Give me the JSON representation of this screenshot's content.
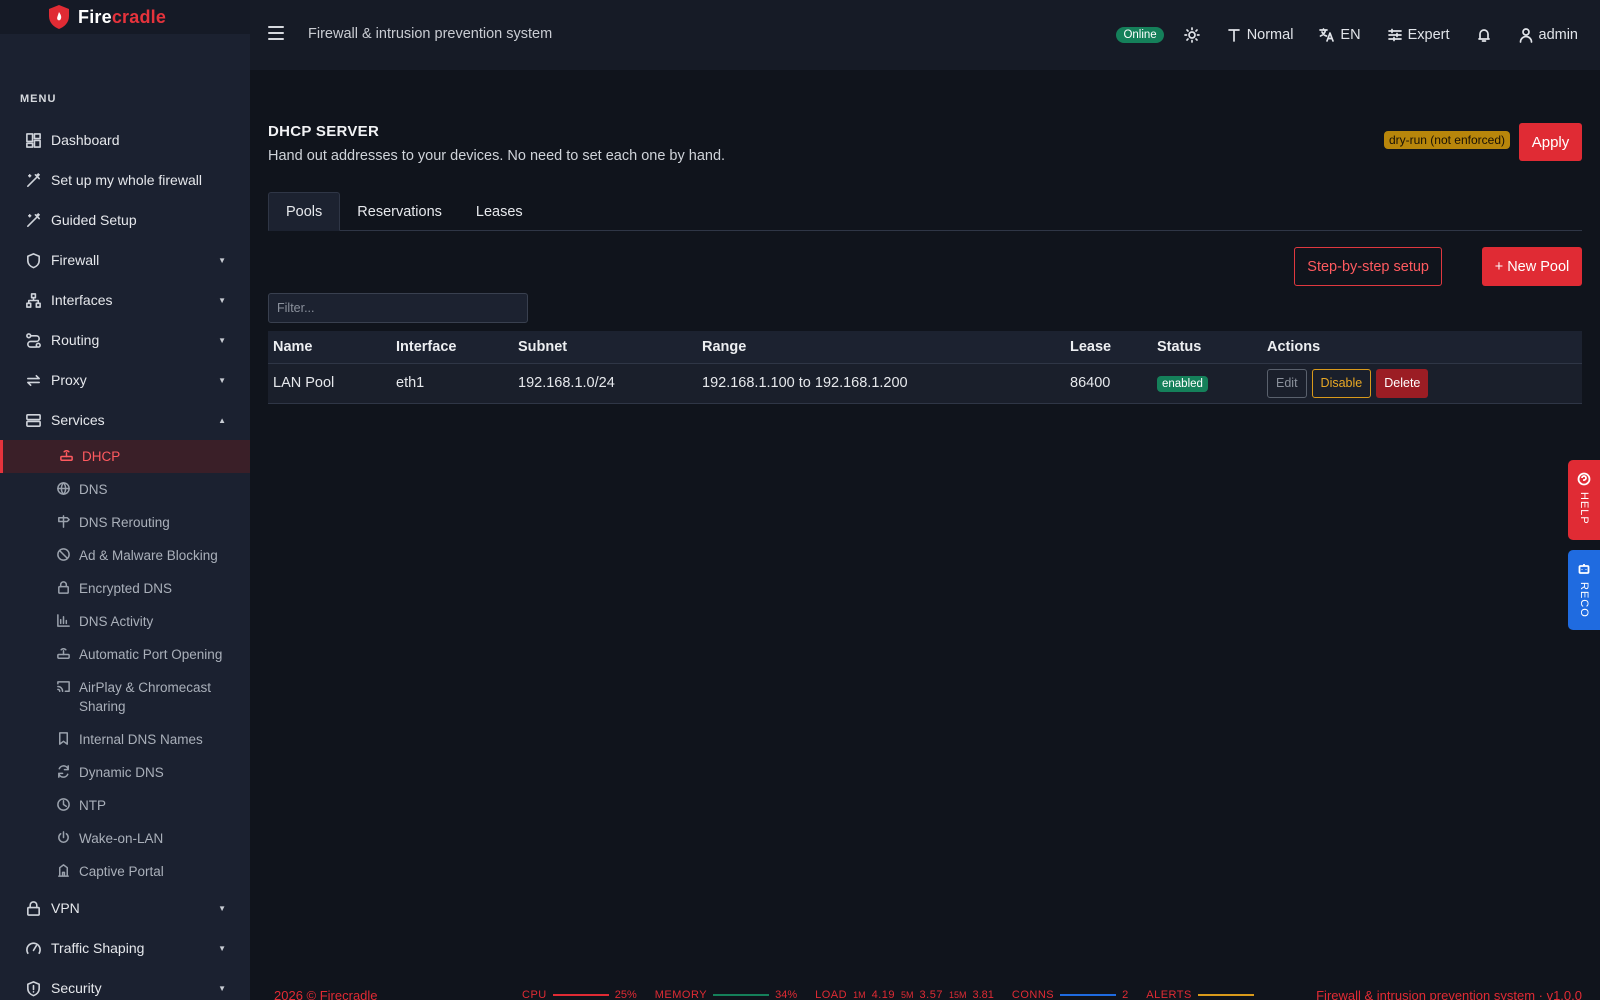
{
  "brand": {
    "prefix": "Fire",
    "suffix": "cradle"
  },
  "sidebar": {
    "menu_heading": "MENU",
    "top_items": [
      {
        "label": "Dashboard"
      },
      {
        "label": "Set up my whole firewall"
      },
      {
        "label": "Guided Setup"
      },
      {
        "label": "Firewall"
      },
      {
        "label": "Interfaces"
      },
      {
        "label": "Routing"
      },
      {
        "label": "Proxy"
      },
      {
        "label": "Services"
      }
    ],
    "services_sub": [
      {
        "label": "DHCP",
        "active": true
      },
      {
        "label": "DNS"
      },
      {
        "label": "DNS Rerouting"
      },
      {
        "label": "Ad & Malware Blocking"
      },
      {
        "label": "Encrypted DNS"
      },
      {
        "label": "DNS Activity"
      },
      {
        "label": "Automatic Port Opening"
      },
      {
        "label": "AirPlay & Chromecast Sharing"
      },
      {
        "label": "Internal DNS Names"
      },
      {
        "label": "Dynamic DNS"
      },
      {
        "label": "NTP"
      },
      {
        "label": "Wake-on-LAN"
      },
      {
        "label": "Captive Portal"
      }
    ],
    "bottom_items": [
      {
        "label": "VPN"
      },
      {
        "label": "Traffic Shaping"
      },
      {
        "label": "Security"
      }
    ]
  },
  "header": {
    "title": "Firewall & intrusion prevention system",
    "status": "Online",
    "font_size": "Normal",
    "language": "EN",
    "mode": "Expert",
    "user": "admin"
  },
  "page": {
    "title": "DHCP SERVER",
    "subtitle": "Hand out addresses to your devices. No need to set each one by hand.",
    "dryrun_badge": "dry-run (not enforced)",
    "apply_label": "Apply",
    "tabs": [
      "Pools",
      "Reservations",
      "Leases"
    ],
    "step_label": "Step-by-step setup",
    "new_pool_label": "+ New Pool",
    "filter_placeholder": "Filter..."
  },
  "table": {
    "headers": [
      "Name",
      "Interface",
      "Subnet",
      "Range",
      "Lease",
      "Status",
      "Actions"
    ],
    "rows": [
      {
        "name": "LAN Pool",
        "interface": "eth1",
        "subnet": "192.168.1.0/24",
        "range": "192.168.1.100 to 192.168.1.200",
        "lease": "86400",
        "status": "enabled",
        "actions": {
          "edit": "Edit",
          "disable": "Disable",
          "delete": "Delete"
        }
      }
    ]
  },
  "side_tabs": {
    "help": "HELP",
    "reco": "RECO"
  },
  "footer": {
    "copyright": "2026 © Firecradle",
    "cpu_label": "CPU",
    "cpu_value": "25%",
    "mem_label": "MEMORY",
    "mem_value": "34%",
    "load_label": "LOAD",
    "load_1m_label": "1M",
    "load_1m": "4.19",
    "load_5m_label": "5M",
    "load_5m": "3.57",
    "load_15m_label": "15M",
    "load_15m": "3.81",
    "conns_label": "CONNS",
    "conns_value": "2",
    "alerts_label": "ALERTS",
    "version": "Firewall & intrusion prevention system · v1.0.0"
  },
  "colors": {
    "accent": "#e02b34",
    "success": "#15805a",
    "warning": "#d99a1b",
    "info": "#1f6be0"
  }
}
